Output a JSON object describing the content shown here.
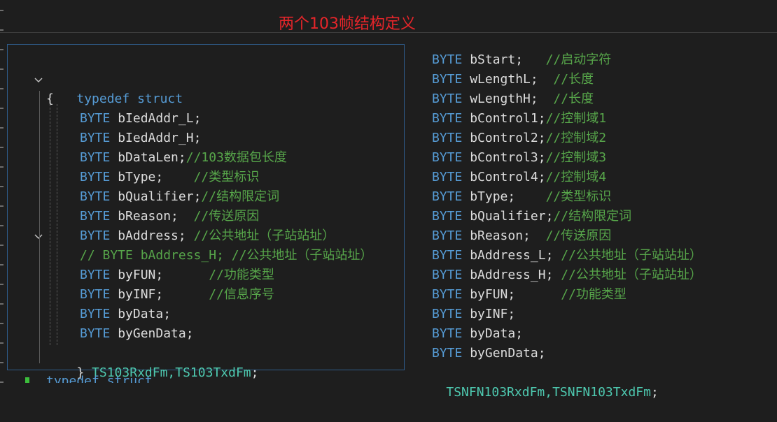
{
  "caption": "两个103帧结构定义",
  "left": {
    "typedef_kw": "typedef",
    "struct_kw": "struct",
    "open_brace": "{",
    "members": [
      {
        "type": "BYTE",
        "name": "bIedAddr_L;",
        "comment": ""
      },
      {
        "type": "BYTE",
        "name": "bIedAddr_H;",
        "comment": ""
      },
      {
        "type": "BYTE",
        "name": "bDataLen;",
        "comment": "//103数据包长度"
      },
      {
        "type": "BYTE",
        "name": "bType;    ",
        "comment": "//类型标识"
      },
      {
        "type": "BYTE",
        "name": "bQualifier;",
        "comment": "//结构限定词"
      },
      {
        "type": "BYTE",
        "name": "bReason;  ",
        "comment": "//传送原因"
      },
      {
        "type": "BYTE",
        "name": "bAddress; ",
        "comment": "//公共地址（子站站址）"
      }
    ],
    "commented_line": "// BYTE bAddress_H; //公共地址（子站站址）",
    "members2": [
      {
        "type": "BYTE",
        "name": "byFUN;      ",
        "comment": "//功能类型"
      },
      {
        "type": "BYTE",
        "name": "byINF;      ",
        "comment": "//信息序号"
      },
      {
        "type": "BYTE",
        "name": "byData;",
        "comment": ""
      },
      {
        "type": "BYTE",
        "name": "byGenData;",
        "comment": ""
      }
    ],
    "close_brace": "}",
    "typedef_names": "TS103RxdFm,TS103TxdFm",
    "semicolon": ";"
  },
  "right": {
    "members": [
      {
        "type": "BYTE",
        "name": "bStart;   ",
        "comment": "//启动字符"
      },
      {
        "type": "BYTE",
        "name": "wLengthL;  ",
        "comment": "//长度"
      },
      {
        "type": "BYTE",
        "name": "wLengthH;  ",
        "comment": "//长度"
      },
      {
        "type": "BYTE",
        "name": "bControl1;",
        "comment": "//控制域1"
      },
      {
        "type": "BYTE",
        "name": "bControl2;",
        "comment": "//控制域2"
      },
      {
        "type": "BYTE",
        "name": "bControl3;",
        "comment": "//控制域3"
      },
      {
        "type": "BYTE",
        "name": "bControl4;",
        "comment": "//控制域4"
      },
      {
        "type": "BYTE",
        "name": "bType;    ",
        "comment": "//类型标识"
      },
      {
        "type": "BYTE",
        "name": "bQualifier;",
        "comment": "//结构限定词"
      },
      {
        "type": "BYTE",
        "name": "bReason;  ",
        "comment": "//传送原因"
      },
      {
        "type": "BYTE",
        "name": "bAddress_L; ",
        "comment": "//公共地址（子站站址）"
      },
      {
        "type": "BYTE",
        "name": "bAddress_H; ",
        "comment": "//公共地址（子站站址）"
      },
      {
        "type": "BYTE",
        "name": "byFUN;      ",
        "comment": "//功能类型"
      },
      {
        "type": "BYTE",
        "name": "byINF;",
        "comment": ""
      },
      {
        "type": "BYTE",
        "name": "byData;",
        "comment": ""
      },
      {
        "type": "BYTE",
        "name": "byGenData;",
        "comment": ""
      }
    ],
    "typedef_names": "TSNFN103RxdFm,TSNFN103TxdFm",
    "semicolon": ";"
  },
  "bottom_fragment": "typedef struct",
  "colors": {
    "keyword": "#569cd6",
    "type": "#4ec9b0",
    "comment": "#57a64a",
    "identifier": "#dcdcdc",
    "caption": "#e5252a",
    "panel_border": "#2f5d8c"
  }
}
